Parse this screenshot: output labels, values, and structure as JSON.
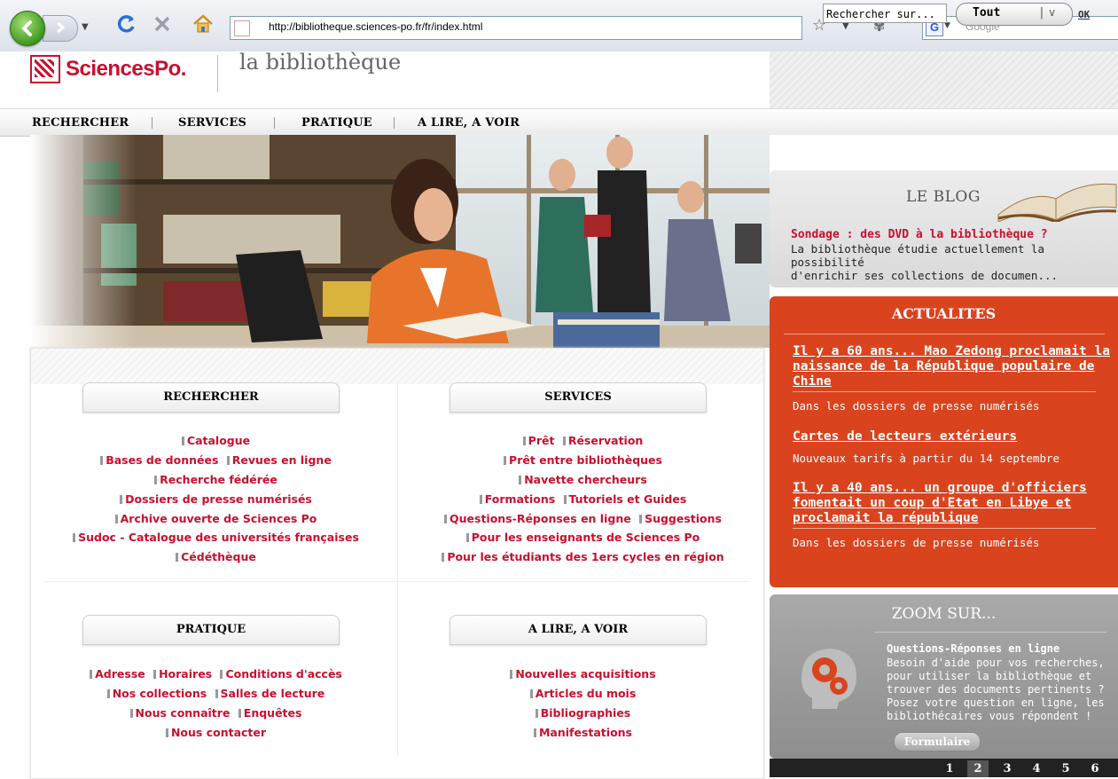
{
  "browser": {
    "url": "http://bibliotheque.sciences-po.fr/fr/index.html",
    "search_engine": "Google",
    "search_placeholder": "Google"
  },
  "header": {
    "brand": "SciencesPo.",
    "subtitle": "la bibliothèque",
    "search_value": "Rechercher sur...",
    "scope_value": "Tout",
    "scope_arrow": "v",
    "ok_label": "OK"
  },
  "mainnav": [
    "RECHERCHER",
    "SERVICES",
    "PRATIQUE",
    "A LIRE, A VOIR"
  ],
  "sections": {
    "rechercher": {
      "title": "RECHERCHER",
      "lines": [
        [
          "Catalogue"
        ],
        [
          "Bases de données",
          "Revues en ligne"
        ],
        [
          "Recherche fédérée"
        ],
        [
          "Dossiers de presse numérisés"
        ],
        [
          "Archive ouverte de Sciences Po"
        ],
        [
          "Sudoc - Catalogue des universités françaises"
        ],
        [
          "Cédéthèque"
        ]
      ]
    },
    "services": {
      "title": "SERVICES",
      "lines": [
        [
          "Prêt",
          "Réservation"
        ],
        [
          "Prêt entre bibliothèques"
        ],
        [
          "Navette chercheurs"
        ],
        [
          "Formations",
          "Tutoriels et Guides"
        ],
        [
          "Questions-Réponses en ligne",
          "Suggestions"
        ],
        [
          "Pour les enseignants de Sciences Po"
        ],
        [
          "Pour les étudiants des 1ers cycles en région"
        ]
      ]
    },
    "pratique": {
      "title": "PRATIQUE",
      "lines": [
        [
          "Adresse",
          "Horaires",
          "Conditions d'accès"
        ],
        [
          "Nos collections",
          "Salles de lecture"
        ],
        [
          "Nous connaître",
          "Enquêtes"
        ],
        [
          "Nous contacter"
        ]
      ]
    },
    "alire": {
      "title": "A LIRE, A VOIR",
      "lines": [
        [
          "Nouvelles acquisitions"
        ],
        [
          "Articles du mois"
        ],
        [
          "Bibliographies"
        ],
        [
          "Manifestations"
        ]
      ]
    }
  },
  "blog": {
    "title": "LE BLOG",
    "post_title": "Sondage : des DVD à la bibliothèque ?",
    "post_text_1": "La bibliothèque étudie actuellement la possibilité",
    "post_text_2": "d'enrichir ses collections de documen..."
  },
  "actualites": {
    "title": "ACTUALITES",
    "items": [
      {
        "title": "Il y a 60 ans... Mao Zedong proclamait la naissance de la République populaire de Chine",
        "desc": "Dans les dossiers de presse numérisés"
      },
      {
        "title": "Cartes de lecteurs extérieurs",
        "desc": "Nouveaux tarifs à partir du 14 septembre"
      },
      {
        "title": "Il y a 40 ans... un groupe d'officiers fomentait un coup d'Etat en Libye et proclamait la république",
        "desc": "Dans les dossiers de presse numérisés"
      }
    ]
  },
  "zoom": {
    "title": "ZOOM SUR...",
    "item_title": "Questions-Réponses en ligne",
    "lines": [
      "Besoin d'aide pour vos recherches,",
      "pour utiliser la bibliothèque et",
      "trouver des documents pertinents ?",
      "Posez votre question en ligne, les",
      "bibliothécaires vous répondent !"
    ],
    "button": "Formulaire",
    "pages": [
      "1",
      "2",
      "3",
      "4",
      "5",
      "6"
    ],
    "active_page": "2"
  },
  "colors": {
    "brand_red": "#c8102e",
    "actu_orange": "#d9441f",
    "zoom_grey": "#9b9b9b"
  }
}
